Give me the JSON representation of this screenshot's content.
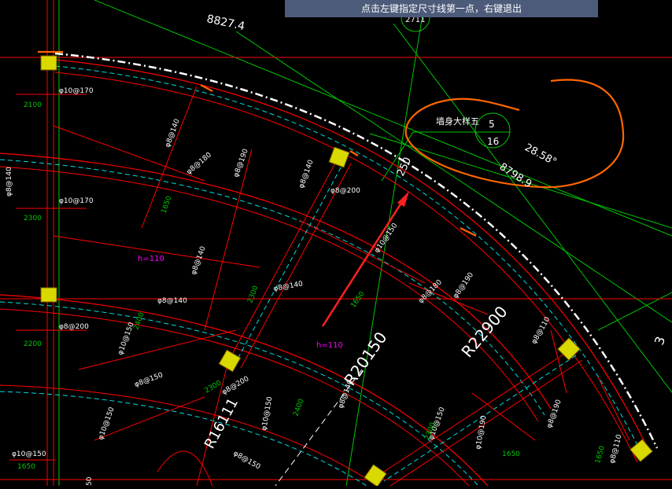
{
  "prompt": "点击左键指定尺寸线第一点，右键退出",
  "colors": {
    "background": "#000000",
    "rebar": "#ff0000",
    "dimension": "#00ff00",
    "dashed": "#00ffff",
    "column": "#d9d900",
    "note": "#ff00ff",
    "markup": "#ff6600",
    "arrow": "#ff2020",
    "prompt_bar": "#4d5b7a"
  },
  "labels": {
    "dim_8827": "8827.4",
    "axis_2711": "2711",
    "detail_title": "墙身大样五",
    "detail_num": "5",
    "detail_sheet": "16",
    "angle": "28.58°",
    "dim_8798": "8798.9",
    "dim_250": "250",
    "r20150": "R20150",
    "r22900": "R22900",
    "r16111": "R16111",
    "h110_a": "h=110",
    "h110_b": "h=110",
    "right_edge": "3"
  },
  "rebar_labels": {
    "a": "φ10@170",
    "b": "2100",
    "c": "φ8@140",
    "d": "φ10@170",
    "e": "2300",
    "f": "φ8@200",
    "g": "2200",
    "h": "φ10@150",
    "i": "1650",
    "j": "φ8@140",
    "k": "1650",
    "l": "φ8@180",
    "m": "φ8@190",
    "n": "φ8@140",
    "o": "φ8@140",
    "p": "2400",
    "q": "φ8@200",
    "r": "φ10@150",
    "s": "1650",
    "t": "φ8@180",
    "u": "φ8@190",
    "v": "2300",
    "w": "φ8@140",
    "x": "φ10@150",
    "y": "2300",
    "z": "φ8@200",
    "aa": "φ8@140",
    "ab": "φ8@150",
    "ac": "φ8@140",
    "ad": "φ10@150",
    "ae": "2400",
    "af": "φ10@150",
    "ag": "φ8@150",
    "ah": "φ8@110",
    "ai": "1650",
    "aj": "φ10@150",
    "ak": "φ10@190",
    "al": "2300",
    "am": "φ8@190",
    "an": "φ8@110",
    "ao": "1650",
    "ap": "50"
  }
}
